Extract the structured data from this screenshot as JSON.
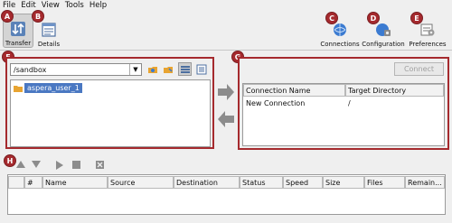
{
  "menubar": {
    "items": [
      "File",
      "Edit",
      "View",
      "Tools",
      "Help"
    ]
  },
  "toolbar": {
    "transfer_label": "Transfer",
    "details_label": "Details",
    "connections_label": "Connections",
    "configuration_label": "Configuration",
    "preferences_label": "Preferences"
  },
  "markers": {
    "a": "A",
    "b": "B",
    "c": "C",
    "d": "D",
    "e": "E",
    "f": "F",
    "g": "G",
    "h": "H"
  },
  "local": {
    "path": "/sandbox",
    "tree_items": [
      "aspera_user_1"
    ]
  },
  "remote": {
    "connect_label": "Connect",
    "columns": [
      "Connection Name",
      "Target Directory"
    ],
    "rows": [
      {
        "name": "New Connection",
        "dir": "/"
      }
    ]
  },
  "queue": {
    "columns": [
      "",
      "#",
      "Name",
      "Source",
      "Destination",
      "Status",
      "Speed",
      "Size",
      "Files",
      "Remain..."
    ]
  },
  "colors": {
    "marker": "#a52a2e",
    "selection": "#4a78c2"
  },
  "icons": [
    "transfer-icon",
    "details-icon",
    "connections-icon",
    "configuration-icon",
    "preferences-icon",
    "folder-icon",
    "arrow-right-icon",
    "arrow-left-icon"
  ]
}
